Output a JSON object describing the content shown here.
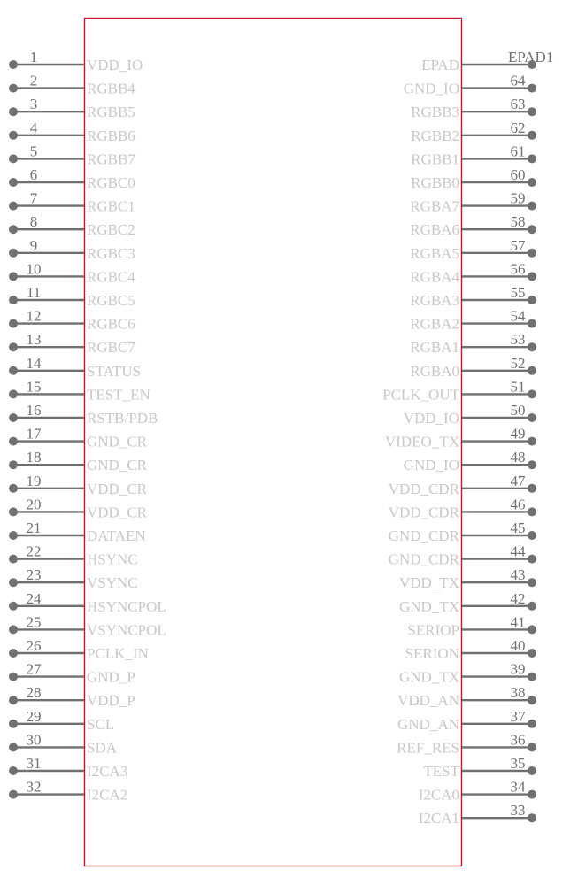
{
  "component": {
    "body_color": "#c8102e",
    "pin_color": "#707070",
    "label_color": "#c8c8c8"
  },
  "left_pins": [
    {
      "number": "1",
      "name": "VDD_IO"
    },
    {
      "number": "2",
      "name": "RGBB4"
    },
    {
      "number": "3",
      "name": "RGBB5"
    },
    {
      "number": "4",
      "name": "RGBB6"
    },
    {
      "number": "5",
      "name": "RGBB7"
    },
    {
      "number": "6",
      "name": "RGBC0"
    },
    {
      "number": "7",
      "name": "RGBC1"
    },
    {
      "number": "8",
      "name": "RGBC2"
    },
    {
      "number": "9",
      "name": "RGBC3"
    },
    {
      "number": "10",
      "name": "RGBC4"
    },
    {
      "number": "11",
      "name": "RGBC5"
    },
    {
      "number": "12",
      "name": "RGBC6"
    },
    {
      "number": "13",
      "name": "RGBC7"
    },
    {
      "number": "14",
      "name": "STATUS"
    },
    {
      "number": "15",
      "name": "TEST_EN"
    },
    {
      "number": "16",
      "name": "RSTB/PDB"
    },
    {
      "number": "17",
      "name": "GND_CR"
    },
    {
      "number": "18",
      "name": "GND_CR"
    },
    {
      "number": "19",
      "name": "VDD_CR"
    },
    {
      "number": "20",
      "name": "VDD_CR"
    },
    {
      "number": "21",
      "name": "DATAEN"
    },
    {
      "number": "22",
      "name": "HSYNC"
    },
    {
      "number": "23",
      "name": "VSYNC"
    },
    {
      "number": "24",
      "name": "HSYNCPOL"
    },
    {
      "number": "25",
      "name": "VSYNCPOL"
    },
    {
      "number": "26",
      "name": "PCLK_IN"
    },
    {
      "number": "27",
      "name": "GND_P"
    },
    {
      "number": "28",
      "name": "VDD_P"
    },
    {
      "number": "29",
      "name": "SCL"
    },
    {
      "number": "30",
      "name": "SDA"
    },
    {
      "number": "31",
      "name": "I2CA3"
    },
    {
      "number": "32",
      "name": "I2CA2"
    }
  ],
  "right_pins": [
    {
      "number": "EPAD1",
      "name": "EPAD"
    },
    {
      "number": "64",
      "name": "GND_IO"
    },
    {
      "number": "63",
      "name": "RGBB3"
    },
    {
      "number": "62",
      "name": "RGBB2"
    },
    {
      "number": "61",
      "name": "RGBB1"
    },
    {
      "number": "60",
      "name": "RGBB0"
    },
    {
      "number": "59",
      "name": "RGBA7"
    },
    {
      "number": "58",
      "name": "RGBA6"
    },
    {
      "number": "57",
      "name": "RGBA5"
    },
    {
      "number": "56",
      "name": "RGBA4"
    },
    {
      "number": "55",
      "name": "RGBA3"
    },
    {
      "number": "54",
      "name": "RGBA2"
    },
    {
      "number": "53",
      "name": "RGBA1"
    },
    {
      "number": "52",
      "name": "RGBA0"
    },
    {
      "number": "51",
      "name": "PCLK_OUT"
    },
    {
      "number": "50",
      "name": "VDD_IO"
    },
    {
      "number": "49",
      "name": "VIDEO_TX"
    },
    {
      "number": "48",
      "name": "GND_IO"
    },
    {
      "number": "47",
      "name": "VDD_CDR"
    },
    {
      "number": "46",
      "name": "VDD_CDR"
    },
    {
      "number": "45",
      "name": "GND_CDR"
    },
    {
      "number": "44",
      "name": "GND_CDR"
    },
    {
      "number": "43",
      "name": "VDD_TX"
    },
    {
      "number": "42",
      "name": "GND_TX"
    },
    {
      "number": "41",
      "name": "SERIOP"
    },
    {
      "number": "40",
      "name": "SERION"
    },
    {
      "number": "39",
      "name": "GND_TX"
    },
    {
      "number": "38",
      "name": "VDD_AN"
    },
    {
      "number": "37",
      "name": "GND_AN"
    },
    {
      "number": "36",
      "name": "REF_RES"
    },
    {
      "number": "35",
      "name": "TEST"
    },
    {
      "number": "34",
      "name": "I2CA0"
    },
    {
      "number": "33",
      "name": "I2CA1"
    }
  ]
}
